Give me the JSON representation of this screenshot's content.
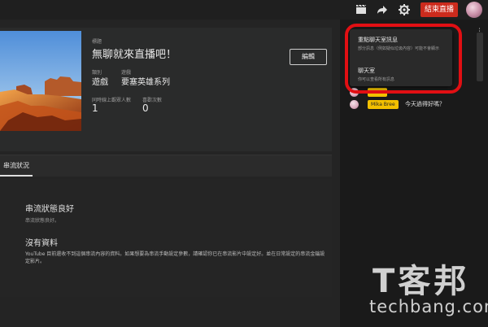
{
  "topbar": {
    "icons": [
      "clapper-icon",
      "share-icon",
      "gear-icon"
    ],
    "end_button": "結束直播"
  },
  "stream": {
    "title_label": "標題",
    "title": "無聊就來直播吧！",
    "category_label": "類別",
    "category": "遊戲",
    "game_label": "遊戲",
    "game": "要塞英雄系列",
    "concurrent_label": "同時線上觀眾人數",
    "concurrent": "1",
    "likes_label": "喜歡次數",
    "likes": "0",
    "edit_button": "編輯"
  },
  "tabs": {
    "stream_health": "串流狀況"
  },
  "health": {
    "title": "串流狀態良好",
    "subtitle": "串流狀態良好。",
    "no_data_title": "沒有資料",
    "no_data_desc": "YouTube 目前還收不到這個串流內容的資料。如果想要為串流手動設定參數，請確認你已在串流影片中設定好。並在日常設定的串流金鑰設定影片。"
  },
  "chat": {
    "menu": [
      {
        "title": "重點聊天室訊息",
        "sub": "部分訊息（例如疑似垃圾內容）可能不會顯示"
      },
      {
        "title": "聊天室",
        "sub": "你可以查看所有訊息"
      }
    ],
    "messages": [
      {
        "user": "Mika Bree",
        "text": "今天過得好嗎？"
      }
    ]
  },
  "watermark": {
    "cn": "T客邦",
    "en": "techbang.com"
  },
  "colors": {
    "accent": "#cc2b1d",
    "highlight_ring": "#e10f13",
    "name_badge": "#f2c000"
  }
}
